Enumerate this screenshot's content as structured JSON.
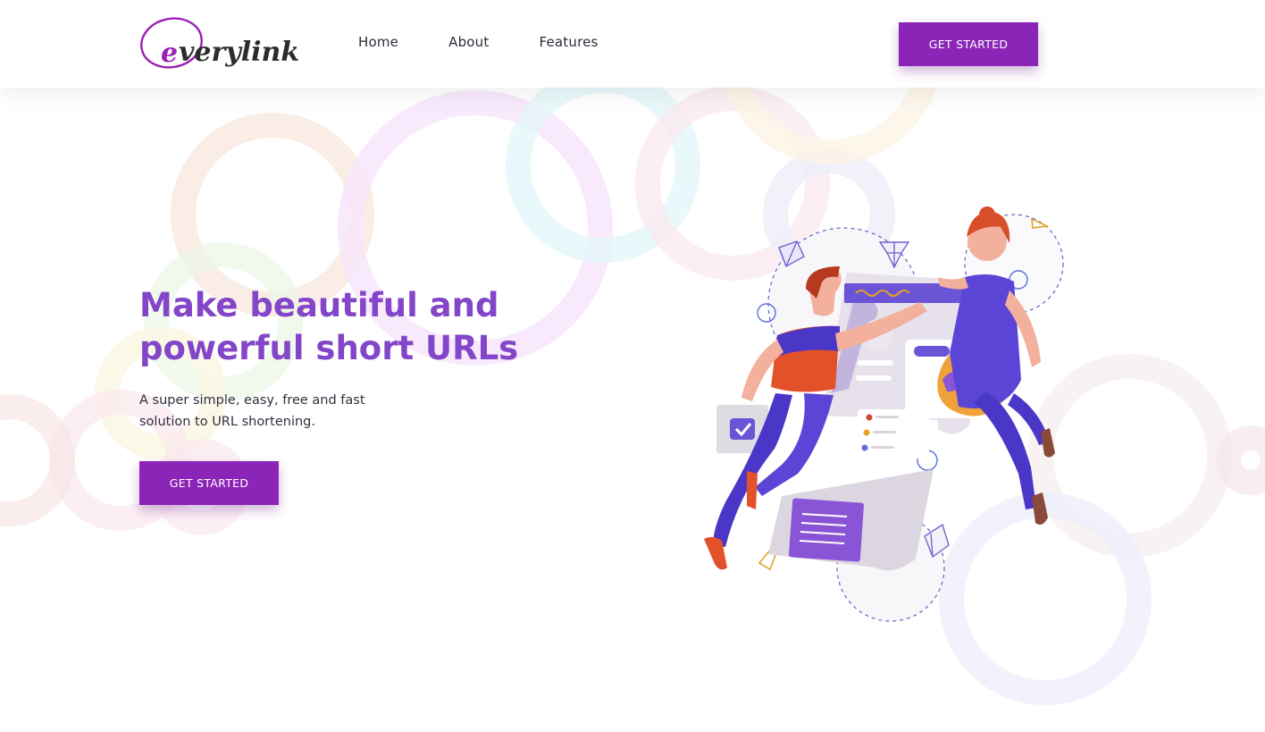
{
  "brand": {
    "logo_text": "everylink",
    "accent": "#8b25b7",
    "title_color": "#8346c9"
  },
  "nav": {
    "items": [
      {
        "label": "Home"
      },
      {
        "label": "About"
      },
      {
        "label": "Features"
      }
    ]
  },
  "header": {
    "cta_label": "GET STARTED"
  },
  "hero": {
    "title": "Make beautiful and powerful short URLs",
    "subtitle": "A super simple, easy, free and fast solution to URL shortening.",
    "cta_label": "GET STARTED"
  },
  "icons": {
    "illustration": "two-people-building-webpage-illustration",
    "check": "checkbox-check-icon"
  }
}
